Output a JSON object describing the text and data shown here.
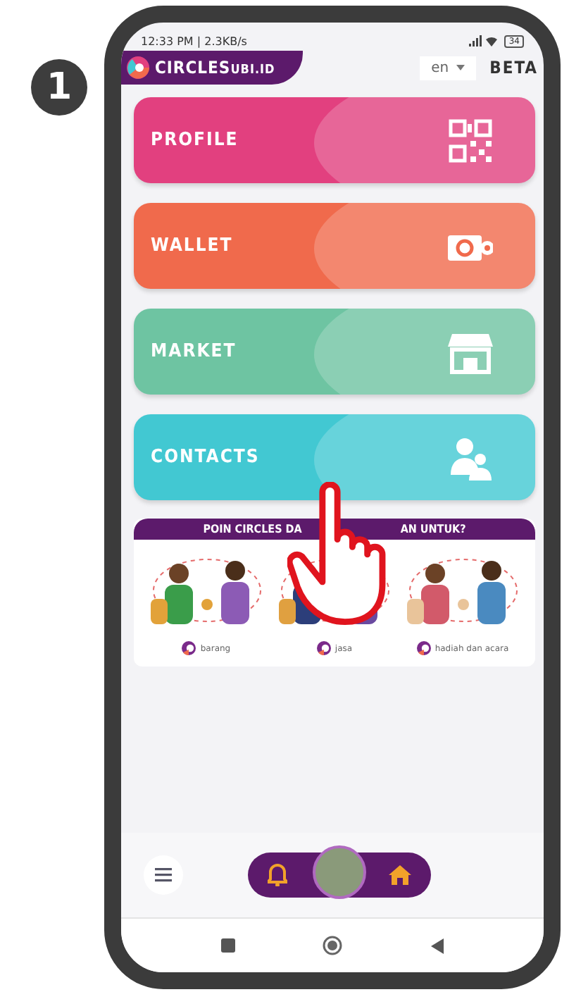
{
  "step_badge": "1",
  "status_bar": {
    "time": "12:33 PM | 2.3KB/s",
    "battery": "34"
  },
  "header": {
    "brand": "CIRCLES",
    "brand_suffix": "UBI.ID",
    "language": "en",
    "badge": "BETA"
  },
  "menu": [
    {
      "label": "PROFILE",
      "color": "#e2407f",
      "kind": "qr"
    },
    {
      "label": "WALLET",
      "color": "#f06a4c",
      "kind": "wallet"
    },
    {
      "label": "MARKET",
      "color": "#6ec4a2",
      "kind": "store"
    },
    {
      "label": "CONTACTS",
      "color": "#42c8d2",
      "kind": "people"
    }
  ],
  "banner": {
    "title_start": "POIN CIRCLES DA",
    "title_end": "AN UNTUK?",
    "items": [
      {
        "label": "barang"
      },
      {
        "label": "jasa"
      },
      {
        "label": "hadiah dan acara"
      }
    ]
  }
}
